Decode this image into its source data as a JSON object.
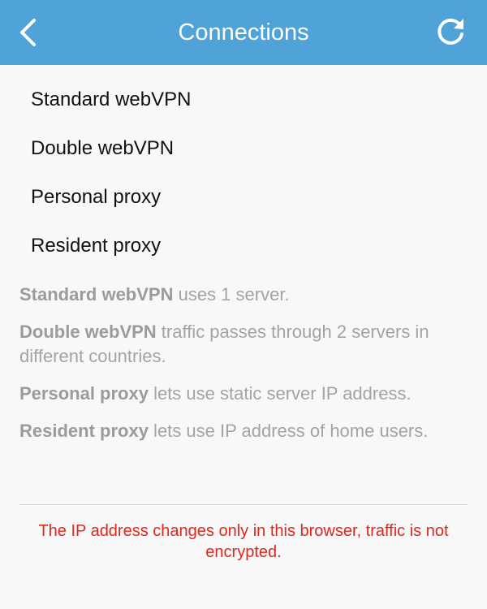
{
  "header": {
    "title": "Connections",
    "back_icon": "chevron-left-icon",
    "refresh_icon": "refresh-icon",
    "background_color": "#4fa3d8"
  },
  "menu": {
    "items": [
      {
        "label": "Standard webVPN"
      },
      {
        "label": "Double webVPN"
      },
      {
        "label": "Personal proxy"
      },
      {
        "label": "Resident proxy"
      }
    ]
  },
  "descriptions": [
    {
      "term": "Standard webVPN",
      "text": " uses 1 server."
    },
    {
      "term": "Double webVPN",
      "text": " traffic passes through 2 servers in different countries."
    },
    {
      "term": "Personal proxy",
      "text": " lets use static server IP address."
    },
    {
      "term": "Resident proxy",
      "text": " lets use IP address of home users."
    }
  ],
  "warning": {
    "text": "The IP address changes only in this browser, traffic is not encrypted.",
    "color": "#e1261c"
  }
}
